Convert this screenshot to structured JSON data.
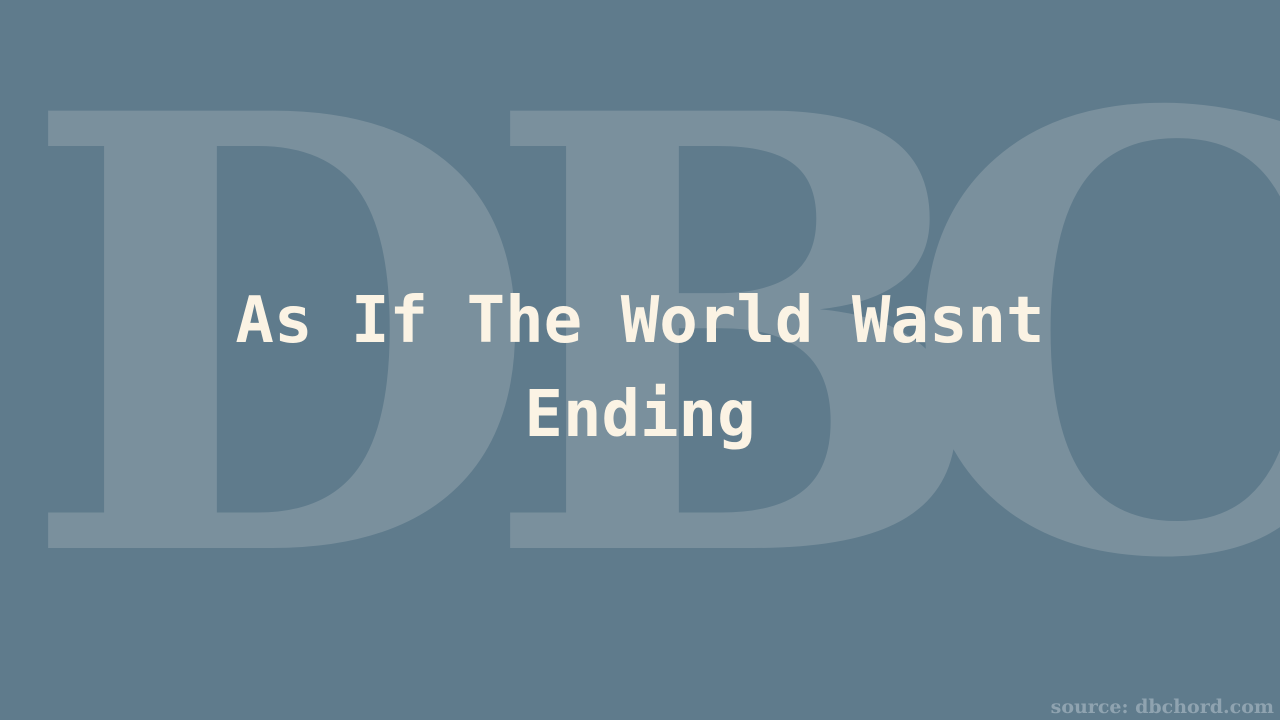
{
  "watermark": {
    "letters": [
      "D",
      "B",
      "C"
    ]
  },
  "title": {
    "line1": "As If The World Wasnt",
    "line2": "Ending"
  },
  "footer": {
    "source": "source: dbchord.com"
  },
  "colors": {
    "background": "#5f7b8c",
    "watermark": "#7a909d",
    "title": "#fbf3e4",
    "source": "#8fa3b0"
  }
}
